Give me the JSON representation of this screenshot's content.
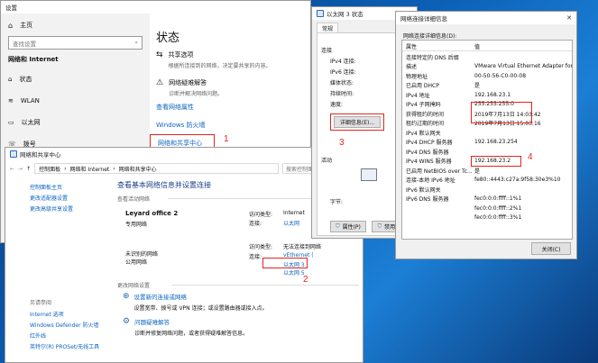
{
  "settings": {
    "title": "设置",
    "home": "主页",
    "search_placeholder": "查找设置",
    "category": "网络和 Internet",
    "nav": [
      "状态",
      "WLAN",
      "以太网",
      "拨号"
    ],
    "page_title": "状态",
    "sharing_title": "共享选项",
    "sharing_desc": "根据所连接到的网络，决定要共享的内容。",
    "troubleshoot_title": "网络疑难解答",
    "troubleshoot_desc": "诊断并解决网络问题。",
    "link_props": "查看网络属性",
    "link_firewall": "Windows 防火墙",
    "link_nsc": "网络和共享中心",
    "link_reset": "网络重置"
  },
  "nsc": {
    "title": "网络和共享中心",
    "breadcrumb": [
      "控制面板",
      "网络和 Internet",
      "网络和共享中心"
    ],
    "search_placeholder": "搜索控制面板",
    "left_links": [
      "控制面板主页",
      "更改适配器设置",
      "更改高级共享设置"
    ],
    "see_also": "另请参阅",
    "see_also_items": [
      "Internet 选项",
      "Windows Defender 防火墙",
      "红外线",
      "英特尔(R) PROSet/无线工具"
    ],
    "heading": "查看基本网络信息并设置连接",
    "active_label": "查看活动网络",
    "net1_name": "Leyard office  2",
    "net1_type": "专用网络",
    "net1_access_label": "访问类型:",
    "net1_access": "Internet",
    "net1_conn_label": "连接:",
    "net1_conn": "以太网",
    "net2_name": "未识别的网络",
    "net2_type": "公用网络",
    "net2_access_label": "访问类型:",
    "net2_access": "无法连接到网络",
    "net2_conn_label": "连接:",
    "net2_conn": [
      "vEthernet (",
      "以太网 3",
      "以太网 5"
    ],
    "change_label": "更改网络设置",
    "task1_title": "设置新的连接或网络",
    "task1_desc": "设置宽带、拨号或 VPN 连接；或设置路由器或接入点。",
    "task2_title": "问题疑难解答",
    "task2_desc": "诊断并修复网络问题，或者获得疑难解答信息。"
  },
  "eth": {
    "title": "以太网 3 状态",
    "tab": "常规",
    "section_conn": "连接",
    "ipv4": "IPv4 连接:",
    "ipv6": "IPv6 连接:",
    "media": "媒体状态:",
    "duration": "持续时间:",
    "speed": "速度:",
    "details_button": "详细信息(E)...",
    "section_activity": "活动",
    "bytes": "字节:",
    "props_button": "属性(P)",
    "disable_button": "禁用(D)"
  },
  "detail": {
    "title": "网络连接详细信息",
    "heading": "网络连接详细信息(D):",
    "col_property": "属性",
    "col_value": "值",
    "rows": [
      {
        "k": "连接特定的 DNS 后缀",
        "v": ""
      },
      {
        "k": "描述",
        "v": "VMware Virtual Ethernet Adapter for"
      },
      {
        "k": "物理地址",
        "v": "00-50-56-C0-00-08"
      },
      {
        "k": "已启用 DHCP",
        "v": "是"
      },
      {
        "k": "IPv4 地址",
        "v": "192.168.23.1"
      },
      {
        "k": "IPv4 子网掩码",
        "v": "255.255.255.0"
      },
      {
        "k": "获得租约的时间",
        "v": "2019年7月13日 14:03:42"
      },
      {
        "k": "租约过期的时间",
        "v": "2019年7月13日 15:03:16"
      },
      {
        "k": "IPv4 默认网关",
        "v": ""
      },
      {
        "k": "IPv4 DHCP 服务器",
        "v": "192.168.23.254"
      },
      {
        "k": "IPv4 DNS 服务器",
        "v": ""
      },
      {
        "k": "IPv4 WINS 服务器",
        "v": "192.168.23.2"
      },
      {
        "k": "已启用 NetBIOS over Tc...",
        "v": "是"
      },
      {
        "k": "连接-本地 IPv6 地址",
        "v": "fe80::4443:c27a:9f58:30e3%10"
      },
      {
        "k": "IPv6 默认网关",
        "v": ""
      },
      {
        "k": "IPv6 DNS 服务器",
        "v": "fec0:0:0:ffff::1%1"
      },
      {
        "k": "",
        "v": "fec0:0:0:ffff::2%1"
      },
      {
        "k": "",
        "v": "fec0:0:0:ffff::3%1"
      }
    ],
    "close_button": "关闭(C)"
  },
  "annotations": [
    "1",
    "2",
    "3",
    "4"
  ],
  "colors": {
    "accent": "#0a63c2",
    "annotation": "#e0251b",
    "desktop": "#0b5fb5"
  }
}
